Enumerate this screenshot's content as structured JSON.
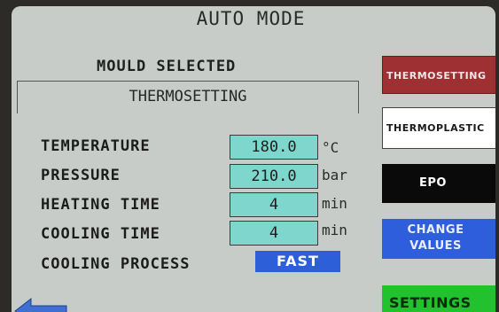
{
  "header": {
    "title": "AUTO MODE"
  },
  "mould": {
    "label": "MOULD SELECTED",
    "value": "THERMOSETTING"
  },
  "parameters": [
    {
      "label": "TEMPERATURE",
      "value": "180.0",
      "unit": "°C"
    },
    {
      "label": "PRESSURE",
      "value": "210.0",
      "unit": "bar"
    },
    {
      "label": "HEATING TIME",
      "value": "4",
      "unit": "min"
    },
    {
      "label": "COOLING TIME",
      "value": "4",
      "unit": "min"
    }
  ],
  "cooling_process": {
    "label": "COOLING PROCESS",
    "value": "FAST"
  },
  "side_buttons": {
    "thermosetting": "THERMOSETTING",
    "thermoplastic": "THERMOPLASTIC",
    "epo": "EPO",
    "change_values": "CHANGE VALUES",
    "settings": "SETTINGS"
  },
  "colors": {
    "screen_bg": "#c8ccc8",
    "field_bg": "#7fd6cd",
    "thermosetting": "#9e2f32",
    "epo": "#0a0a0a",
    "change_values": "#2f5edc",
    "settings": "#22c12e",
    "cooling_fast": "#2d5fd8"
  },
  "icons": {
    "back": "left-arrow-icon"
  }
}
